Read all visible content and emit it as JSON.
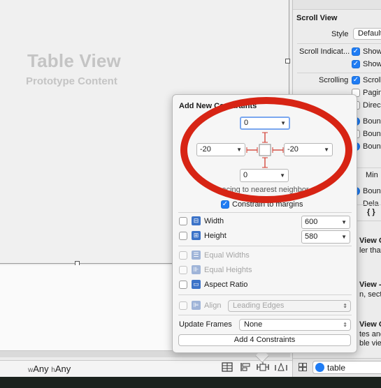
{
  "canvas": {
    "table_view_title": "Table View",
    "table_view_subtitle": "Prototype Content"
  },
  "bottom_bar": {
    "width_prefix": "w",
    "width_value": "Any",
    "height_prefix": "h",
    "height_value": "Any",
    "icons": [
      "stack-icon",
      "align-icon",
      "pin-icon",
      "resolve-icon"
    ]
  },
  "inspector": {
    "section_title": "Scroll View",
    "style_label": "Style",
    "style_value": "Default",
    "scroll_indicators_label": "Scroll Indicat...",
    "show_1": "Show",
    "show_2": "Show",
    "scrolling_label": "Scrolling",
    "scroll_opt": "Scroll",
    "paging_opt": "Pagin",
    "direction_opt": "Direc",
    "bounce_1": "Boun",
    "bounce_2": "Boun",
    "bounce_3": "Boun",
    "min_label": "Min",
    "bounce_4": "Boun",
    "delay_opt": "Dela",
    "braces": "{ }",
    "view_c_1": "View C",
    "view_c_1_sub": "ler that",
    "view_2": "View -",
    "view_2_sub": "n, secti",
    "view_c_3": "View C",
    "view_c_3_sub1": "tes and",
    "view_c_3_sub2": "ble view",
    "search_value": "table"
  },
  "constraints_popover": {
    "title": "Add New Constraints",
    "top_value": "0",
    "left_value": "-20",
    "right_value": "-20",
    "bottom_value": "0",
    "spacing_label": "Spacing to nearest neighbor",
    "constrain_margins_label": "Constrain to margins",
    "width_label": "Width",
    "width_value": "600",
    "height_label": "Height",
    "height_value": "580",
    "equal_widths_label": "Equal Widths",
    "equal_heights_label": "Equal Heights",
    "aspect_ratio_label": "Aspect Ratio",
    "align_label": "Align",
    "align_value": "Leading Edges",
    "update_frames_label": "Update Frames",
    "update_frames_value": "None",
    "add_button_label": "Add 4 Constraints"
  },
  "colors": {
    "accent": "#1f7cf4",
    "annotation_red": "#d72414"
  }
}
